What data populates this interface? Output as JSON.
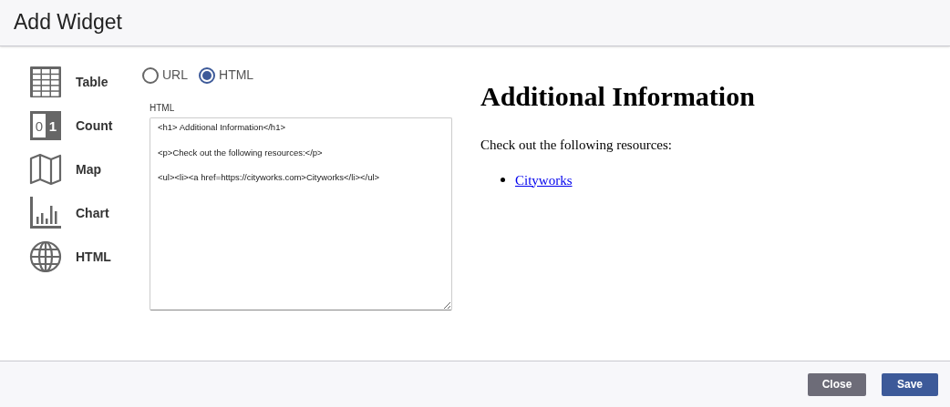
{
  "dialog": {
    "title": "Add Widget"
  },
  "widget_types": [
    {
      "kind": "table",
      "label": "Table"
    },
    {
      "kind": "count",
      "label": "Count",
      "digits": [
        "0",
        "1"
      ]
    },
    {
      "kind": "map",
      "label": "Map"
    },
    {
      "kind": "chart",
      "label": "Chart"
    },
    {
      "kind": "html",
      "label": "HTML"
    }
  ],
  "source_options": [
    {
      "label": "URL",
      "selected": false
    },
    {
      "label": "HTML",
      "selected": true
    }
  ],
  "html_field": {
    "label": "HTML",
    "value": "<h1> Additional Information</h1>\n\n<p>Check out the following resources:</p>\n\n<ul><li><a href=https://cityworks.com>Cityworks</li></ul>"
  },
  "preview": {
    "heading": "Additional Information",
    "paragraph": "Check out the following resources:",
    "links": [
      "Cityworks"
    ]
  },
  "buttons": [
    {
      "kind": "secondary",
      "label": "Close"
    },
    {
      "kind": "primary",
      "label": "Save"
    }
  ]
}
